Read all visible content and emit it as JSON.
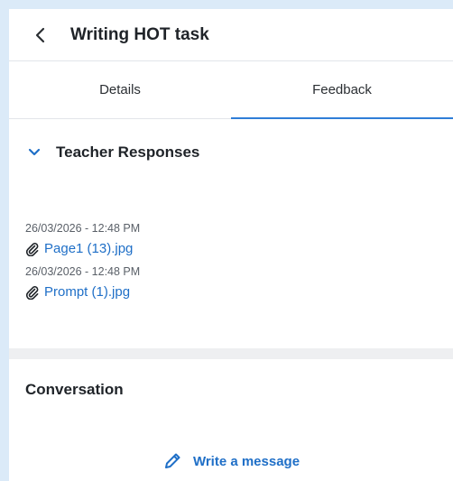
{
  "header": {
    "title": "Writing HOT task"
  },
  "tabs": [
    {
      "label": "Details",
      "active": false
    },
    {
      "label": "Feedback",
      "active": true
    }
  ],
  "teacher_responses": {
    "title": "Teacher Responses",
    "expanded": true,
    "items": [
      {
        "timestamp": "26/03/2026 - 12:48 PM",
        "file": "Page1 (13).jpg"
      },
      {
        "timestamp": "26/03/2026 - 12:48 PM",
        "file": "Prompt (1).jpg"
      }
    ]
  },
  "conversation": {
    "title": "Conversation",
    "write_label": "Write a message"
  },
  "colors": {
    "accent": "#2f7ed8",
    "link": "#1f6fc7",
    "background": "#dbeaf8"
  },
  "icons": {
    "back": "chevron-left-icon",
    "collapse": "chevron-down-icon",
    "attachment": "paperclip-icon",
    "write": "pencil-icon"
  }
}
